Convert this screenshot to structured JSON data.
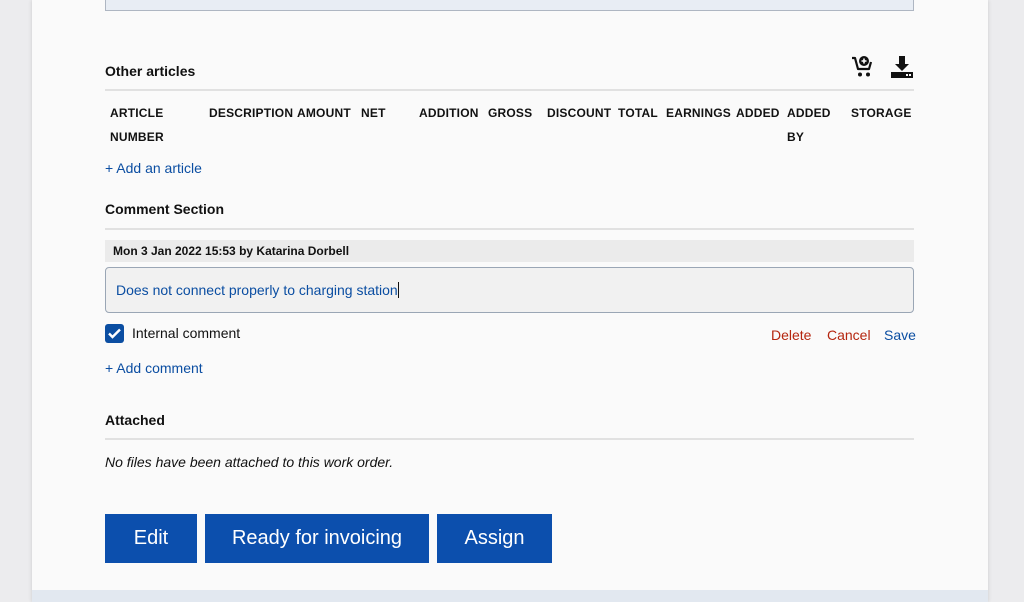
{
  "other_articles": {
    "title": "Other articles",
    "icons": [
      "cart-add-icon",
      "download-icon"
    ],
    "columns": [
      "ARTICLE NUMBER",
      "DESCRIPTION",
      "AMOUNT",
      "NET",
      "ADDITION",
      "GROSS",
      "DISCOUNT",
      "TOTAL",
      "EARNINGS",
      "ADDED",
      "ADDED BY",
      "STORAGE"
    ],
    "add_link": "+ Add an article"
  },
  "comments": {
    "title": "Comment Section",
    "meta": "Mon 3 Jan 2022 15:53 by Katarina Dorbell",
    "value": "Does not connect properly to charging station",
    "internal_label": "Internal comment",
    "internal_checked": true,
    "delete": "Delete",
    "cancel": "Cancel",
    "save": "Save",
    "add_link": "+ Add comment"
  },
  "attached": {
    "title": "Attached",
    "empty_text": "No files have been attached to this work order."
  },
  "buttons": {
    "edit": "Edit",
    "ready": "Ready for invoicing",
    "assign": "Assign"
  },
  "colors": {
    "accent": "#0c4fad",
    "link": "#0b4ea2",
    "danger": "#b5260f"
  }
}
